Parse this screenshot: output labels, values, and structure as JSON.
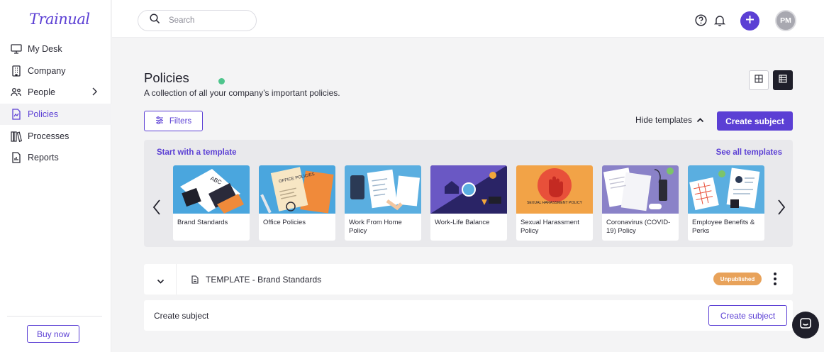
{
  "app": {
    "logo": "Trainual"
  },
  "sidebar": {
    "items": [
      {
        "label": "My Desk",
        "icon": "monitor-icon"
      },
      {
        "label": "Company",
        "icon": "building-icon"
      },
      {
        "label": "People",
        "icon": "people-icon"
      },
      {
        "label": "Policies",
        "icon": "policy-doc-icon",
        "active": true
      },
      {
        "label": "Processes",
        "icon": "books-icon"
      },
      {
        "label": "Reports",
        "icon": "report-icon"
      }
    ],
    "buy_now": "Buy now"
  },
  "topbar": {
    "search_placeholder": "Search",
    "avatar_initials": "PM"
  },
  "page": {
    "title": "Policies",
    "description": "A collection of all your company’s important policies.",
    "filters_label": "Filters",
    "hide_templates_label": "Hide templates",
    "create_subject_label": "Create subject"
  },
  "templates": {
    "start_label": "Start with a template",
    "see_all_label": "See all templates",
    "cards": [
      {
        "label": "Brand Standards"
      },
      {
        "label": "Office Policies",
        "thumb_text": "OFFICE POLICIES"
      },
      {
        "label": "Work From Home Policy"
      },
      {
        "label": "Work-Life Balance"
      },
      {
        "label": "Sexual Harassment Policy",
        "thumb_text": "SEXUAL HARASSMENT POLICY"
      },
      {
        "label": "Coronavirus (COVID-19) Policy"
      },
      {
        "label": "Employee Benefits & Perks"
      }
    ]
  },
  "subjects": [
    {
      "title": "TEMPLATE - Brand Standards",
      "status": "Unpublished"
    }
  ],
  "create_row": {
    "label": "Create subject",
    "button": "Create subject"
  },
  "colors": {
    "accent": "#5b3fd4",
    "badge": "#e8a25a",
    "status_dot": "#4fc58d"
  }
}
